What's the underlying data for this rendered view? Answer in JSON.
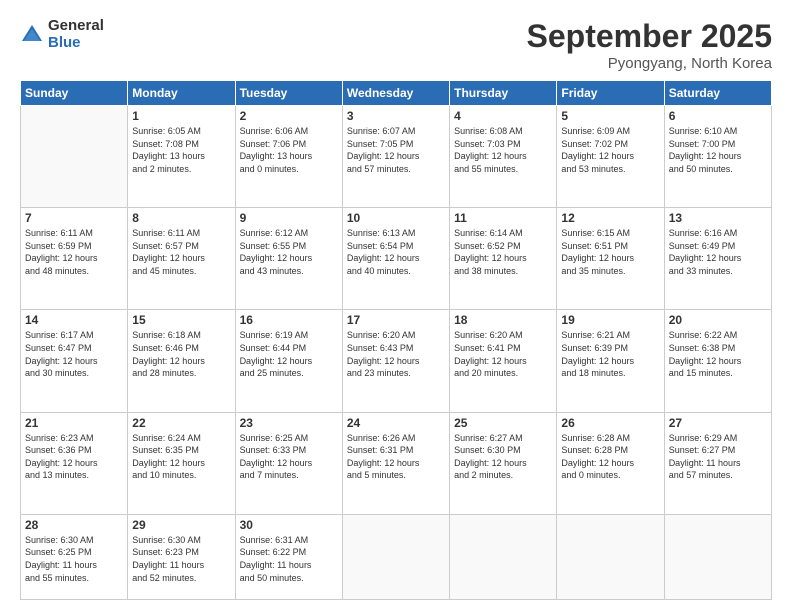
{
  "logo": {
    "general": "General",
    "blue": "Blue"
  },
  "header": {
    "month": "September 2025",
    "location": "Pyongyang, North Korea"
  },
  "weekdays": [
    "Sunday",
    "Monday",
    "Tuesday",
    "Wednesday",
    "Thursday",
    "Friday",
    "Saturday"
  ],
  "weeks": [
    [
      {
        "day": "",
        "info": ""
      },
      {
        "day": "1",
        "info": "Sunrise: 6:05 AM\nSunset: 7:08 PM\nDaylight: 13 hours\nand 2 minutes."
      },
      {
        "day": "2",
        "info": "Sunrise: 6:06 AM\nSunset: 7:06 PM\nDaylight: 13 hours\nand 0 minutes."
      },
      {
        "day": "3",
        "info": "Sunrise: 6:07 AM\nSunset: 7:05 PM\nDaylight: 12 hours\nand 57 minutes."
      },
      {
        "day": "4",
        "info": "Sunrise: 6:08 AM\nSunset: 7:03 PM\nDaylight: 12 hours\nand 55 minutes."
      },
      {
        "day": "5",
        "info": "Sunrise: 6:09 AM\nSunset: 7:02 PM\nDaylight: 12 hours\nand 53 minutes."
      },
      {
        "day": "6",
        "info": "Sunrise: 6:10 AM\nSunset: 7:00 PM\nDaylight: 12 hours\nand 50 minutes."
      }
    ],
    [
      {
        "day": "7",
        "info": "Sunrise: 6:11 AM\nSunset: 6:59 PM\nDaylight: 12 hours\nand 48 minutes."
      },
      {
        "day": "8",
        "info": "Sunrise: 6:11 AM\nSunset: 6:57 PM\nDaylight: 12 hours\nand 45 minutes."
      },
      {
        "day": "9",
        "info": "Sunrise: 6:12 AM\nSunset: 6:55 PM\nDaylight: 12 hours\nand 43 minutes."
      },
      {
        "day": "10",
        "info": "Sunrise: 6:13 AM\nSunset: 6:54 PM\nDaylight: 12 hours\nand 40 minutes."
      },
      {
        "day": "11",
        "info": "Sunrise: 6:14 AM\nSunset: 6:52 PM\nDaylight: 12 hours\nand 38 minutes."
      },
      {
        "day": "12",
        "info": "Sunrise: 6:15 AM\nSunset: 6:51 PM\nDaylight: 12 hours\nand 35 minutes."
      },
      {
        "day": "13",
        "info": "Sunrise: 6:16 AM\nSunset: 6:49 PM\nDaylight: 12 hours\nand 33 minutes."
      }
    ],
    [
      {
        "day": "14",
        "info": "Sunrise: 6:17 AM\nSunset: 6:47 PM\nDaylight: 12 hours\nand 30 minutes."
      },
      {
        "day": "15",
        "info": "Sunrise: 6:18 AM\nSunset: 6:46 PM\nDaylight: 12 hours\nand 28 minutes."
      },
      {
        "day": "16",
        "info": "Sunrise: 6:19 AM\nSunset: 6:44 PM\nDaylight: 12 hours\nand 25 minutes."
      },
      {
        "day": "17",
        "info": "Sunrise: 6:20 AM\nSunset: 6:43 PM\nDaylight: 12 hours\nand 23 minutes."
      },
      {
        "day": "18",
        "info": "Sunrise: 6:20 AM\nSunset: 6:41 PM\nDaylight: 12 hours\nand 20 minutes."
      },
      {
        "day": "19",
        "info": "Sunrise: 6:21 AM\nSunset: 6:39 PM\nDaylight: 12 hours\nand 18 minutes."
      },
      {
        "day": "20",
        "info": "Sunrise: 6:22 AM\nSunset: 6:38 PM\nDaylight: 12 hours\nand 15 minutes."
      }
    ],
    [
      {
        "day": "21",
        "info": "Sunrise: 6:23 AM\nSunset: 6:36 PM\nDaylight: 12 hours\nand 13 minutes."
      },
      {
        "day": "22",
        "info": "Sunrise: 6:24 AM\nSunset: 6:35 PM\nDaylight: 12 hours\nand 10 minutes."
      },
      {
        "day": "23",
        "info": "Sunrise: 6:25 AM\nSunset: 6:33 PM\nDaylight: 12 hours\nand 7 minutes."
      },
      {
        "day": "24",
        "info": "Sunrise: 6:26 AM\nSunset: 6:31 PM\nDaylight: 12 hours\nand 5 minutes."
      },
      {
        "day": "25",
        "info": "Sunrise: 6:27 AM\nSunset: 6:30 PM\nDaylight: 12 hours\nand 2 minutes."
      },
      {
        "day": "26",
        "info": "Sunrise: 6:28 AM\nSunset: 6:28 PM\nDaylight: 12 hours\nand 0 minutes."
      },
      {
        "day": "27",
        "info": "Sunrise: 6:29 AM\nSunset: 6:27 PM\nDaylight: 11 hours\nand 57 minutes."
      }
    ],
    [
      {
        "day": "28",
        "info": "Sunrise: 6:30 AM\nSunset: 6:25 PM\nDaylight: 11 hours\nand 55 minutes."
      },
      {
        "day": "29",
        "info": "Sunrise: 6:30 AM\nSunset: 6:23 PM\nDaylight: 11 hours\nand 52 minutes."
      },
      {
        "day": "30",
        "info": "Sunrise: 6:31 AM\nSunset: 6:22 PM\nDaylight: 11 hours\nand 50 minutes."
      },
      {
        "day": "",
        "info": ""
      },
      {
        "day": "",
        "info": ""
      },
      {
        "day": "",
        "info": ""
      },
      {
        "day": "",
        "info": ""
      }
    ]
  ]
}
